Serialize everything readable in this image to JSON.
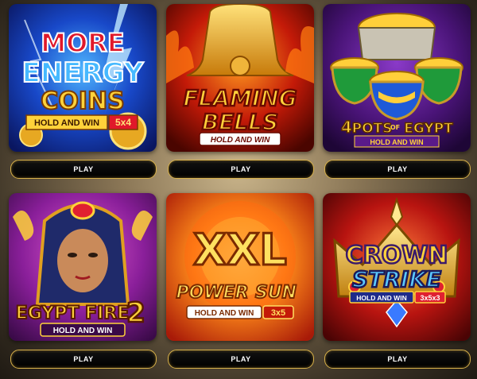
{
  "colors": {
    "play_border": "#d9b24a",
    "play_bg": "#000000",
    "play_text": "#ffffff"
  },
  "games": [
    {
      "title_lines": [
        "MORE",
        "ENERGY",
        "COINS"
      ],
      "badge": "HOLD AND WIN",
      "badge_extra": "5x4",
      "play_label": "PLAY"
    },
    {
      "title_lines": [
        "FLAMING",
        "BELLS"
      ],
      "badge": "HOLD AND WIN",
      "play_label": "PLAY"
    },
    {
      "title_lines": [
        "4",
        "POTS",
        "OF",
        "EGYPT"
      ],
      "badge": "HOLD AND WIN",
      "play_label": "PLAY"
    },
    {
      "title_lines": [
        "EGYPT FIRE",
        "2"
      ],
      "badge": "HOLD AND WIN",
      "play_label": "PLAY"
    },
    {
      "title_lines": [
        "XXL",
        "POWER",
        "SUN"
      ],
      "badge": "HOLD AND WIN",
      "badge_extra": "3x5",
      "play_label": "PLAY"
    },
    {
      "title_lines": [
        "CROWN",
        "STRIKE"
      ],
      "badge": "HOLD AND WIN",
      "badge_extra": "3x5x3",
      "play_label": "PLAY"
    }
  ]
}
